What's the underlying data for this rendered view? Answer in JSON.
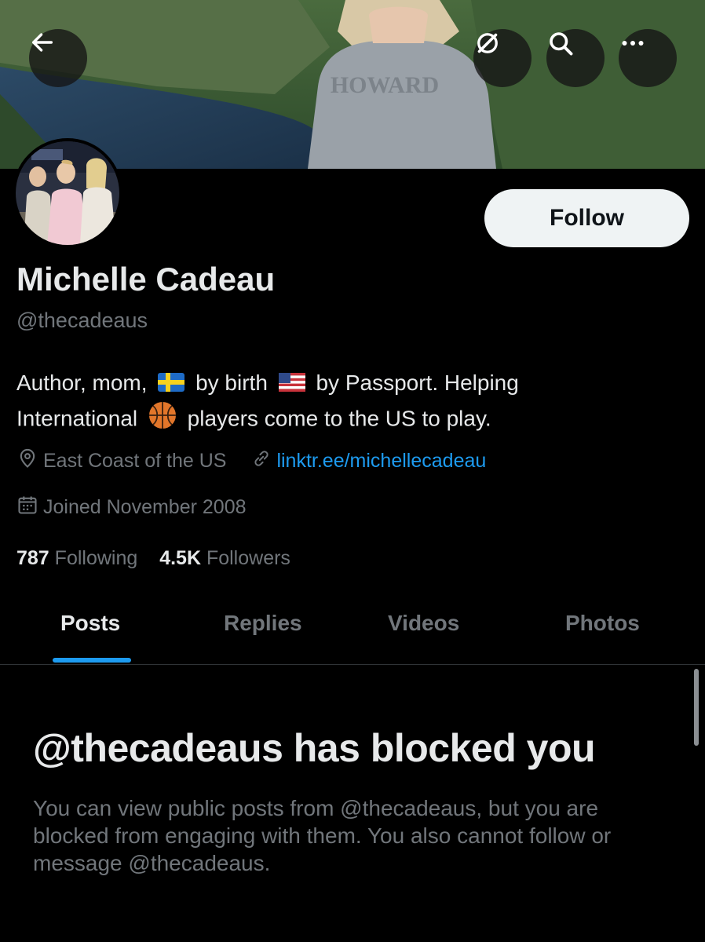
{
  "profile": {
    "name": "Michelle Cadeau",
    "handle": "@thecadeaus",
    "bio": {
      "part1": "Author, mom,",
      "part2": "by birth",
      "part3": "by Passport. Helping",
      "part4": "International",
      "part5": "players come to the US to play."
    },
    "location": "East Coast of the US",
    "website": "linktr.ee/michellecadeau",
    "joined": "Joined November 2008",
    "following_count": "787",
    "following_label": "Following",
    "followers_count": "4.5K",
    "followers_label": "Followers"
  },
  "actions": {
    "follow_label": "Follow"
  },
  "icons": {
    "back": "arrow-left-icon",
    "grok": "grok-icon",
    "search": "search-icon",
    "more": "more-icon",
    "location": "location-pin-icon",
    "link": "link-icon",
    "calendar": "calendar-icon"
  },
  "tabs": [
    {
      "label": "Posts",
      "active": true
    },
    {
      "label": "Replies",
      "active": false
    },
    {
      "label": "Videos",
      "active": false
    },
    {
      "label": "Photos",
      "active": false
    }
  ],
  "blocked": {
    "title": "@thecadeaus has blocked you",
    "body": "You can view public posts from @thecadeaus, but you are blocked from engaging with them. You also cannot follow or message @thecadeaus."
  },
  "colors": {
    "accent": "#1d9bf0",
    "background": "#000000",
    "text_primary": "#e7e9ea",
    "text_secondary": "#71767b"
  }
}
